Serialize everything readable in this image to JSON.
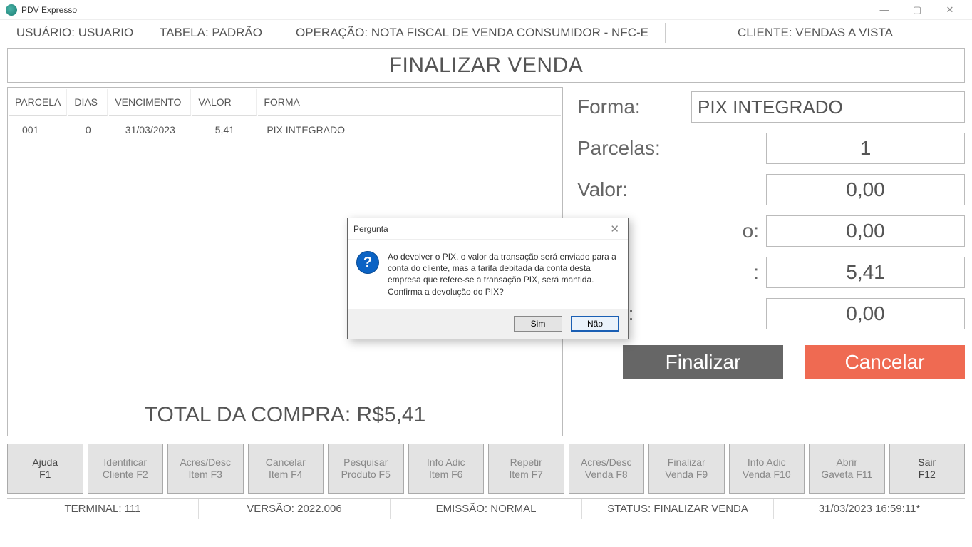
{
  "window": {
    "title": "PDV Expresso"
  },
  "top": {
    "usuario": "USUÁRIO: USUARIO",
    "tabela": "TABELA: PADRÃO",
    "operacao": "OPERAÇÃO: NOTA FISCAL DE VENDA CONSUMIDOR - NFC-E",
    "cliente": "CLIENTE: VENDAS A VISTA"
  },
  "page_title": "FINALIZAR VENDA",
  "table": {
    "headers": {
      "parcela": "PARCELA",
      "dias": "DIAS",
      "venc": "VENCIMENTO",
      "valor": "VALOR",
      "forma": "FORMA"
    },
    "rows": [
      {
        "parcela": "001",
        "dias": "0",
        "venc": "31/03/2023",
        "valor": "5,41",
        "forma": "PIX INTEGRADO"
      }
    ]
  },
  "total_label": "TOTAL DA COMPRA: R$5,41",
  "form": {
    "forma_label": "Forma:",
    "forma_value": "PIX INTEGRADO",
    "parcelas_label": "Parcelas:",
    "parcelas_value": "1",
    "valor_label": "Valor:",
    "valor_value": "0,00",
    "field4_label": "o:",
    "field4_value": "0,00",
    "field5_label": ":",
    "field5_value": "5,41",
    "saldo_label": "Saldo:",
    "saldo_value": "0,00"
  },
  "actions": {
    "finalizar": "Finalizar",
    "cancelar": "Cancelar"
  },
  "fkeys": [
    {
      "l1": "Ajuda",
      "l2": "F1",
      "active": true
    },
    {
      "l1": "Identificar",
      "l2": "Cliente F2",
      "active": false
    },
    {
      "l1": "Acres/Desc",
      "l2": "Item F3",
      "active": false
    },
    {
      "l1": "Cancelar",
      "l2": "Item F4",
      "active": false
    },
    {
      "l1": "Pesquisar",
      "l2": "Produto F5",
      "active": false
    },
    {
      "l1": "Info Adic",
      "l2": "Item F6",
      "active": false
    },
    {
      "l1": "Repetir",
      "l2": "Item F7",
      "active": false
    },
    {
      "l1": "Acres/Desc",
      "l2": "Venda F8",
      "active": false
    },
    {
      "l1": "Finalizar",
      "l2": "Venda F9",
      "active": false
    },
    {
      "l1": "Info Adic",
      "l2": "Venda F10",
      "active": false
    },
    {
      "l1": "Abrir",
      "l2": "Gaveta F11",
      "active": false
    },
    {
      "l1": "Sair",
      "l2": "F12",
      "active": true
    }
  ],
  "status": {
    "terminal": "TERMINAL: 111",
    "versao": "VERSÃO: 2022.006",
    "emissao": "EMISSÃO: NORMAL",
    "status": "STATUS: FINALIZAR VENDA",
    "datetime": "31/03/2023 16:59:11*"
  },
  "modal": {
    "title": "Pergunta",
    "text": "Ao devolver o PIX, o valor da transação será enviado para a conta do cliente, mas a tarifa debitada da conta desta empresa que refere-se a transação PIX, será mantida. Confirma a devolução do PIX?",
    "yes": "Sim",
    "no": "Não"
  }
}
